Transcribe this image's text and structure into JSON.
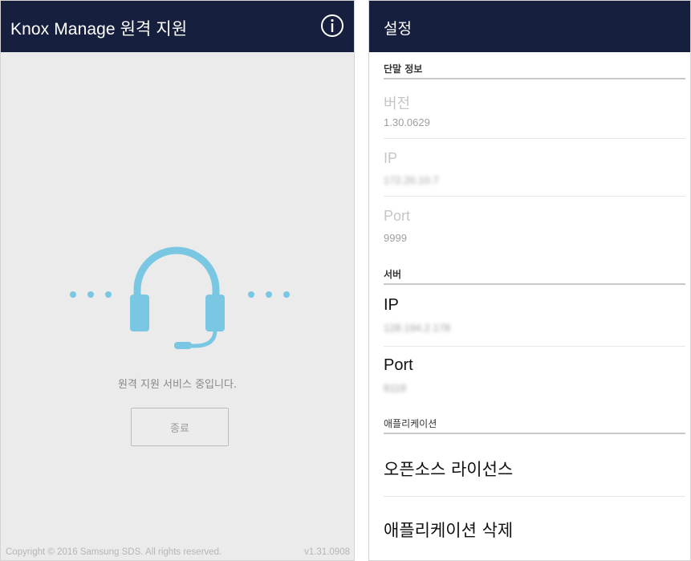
{
  "left_screen": {
    "title": "Knox Manage 원격 지원",
    "status_text": "원격 지원 서비스 중입니다.",
    "end_button_label": "종료",
    "copyright": "Copyright © 2016 Samsung SDS. All rights reserved.",
    "version": "v1.31.0908",
    "icons": [
      "info-icon",
      "headset-icon",
      "dots-left",
      "dots-right"
    ],
    "colors": {
      "appbar": "#16203e",
      "accent": "#79c7e3",
      "background": "#ebebeb"
    }
  },
  "right_screen": {
    "title": "설정",
    "device_info": {
      "header": "단말 정보",
      "version": {
        "label": "버전",
        "value": "1.30.0629"
      },
      "ip": {
        "label": "IP",
        "value": "172.20.10.7"
      },
      "port": {
        "label": "Port",
        "value": "9999"
      }
    },
    "server": {
      "header": "서버",
      "ip": {
        "label": "IP",
        "value": "128.194.2.178"
      },
      "port": {
        "label": "Port",
        "value": "8118"
      }
    },
    "application": {
      "header": "애플리케이션",
      "open_source_license": "오픈소스 라이선스",
      "delete_application": "애플리케이션 삭제"
    }
  }
}
